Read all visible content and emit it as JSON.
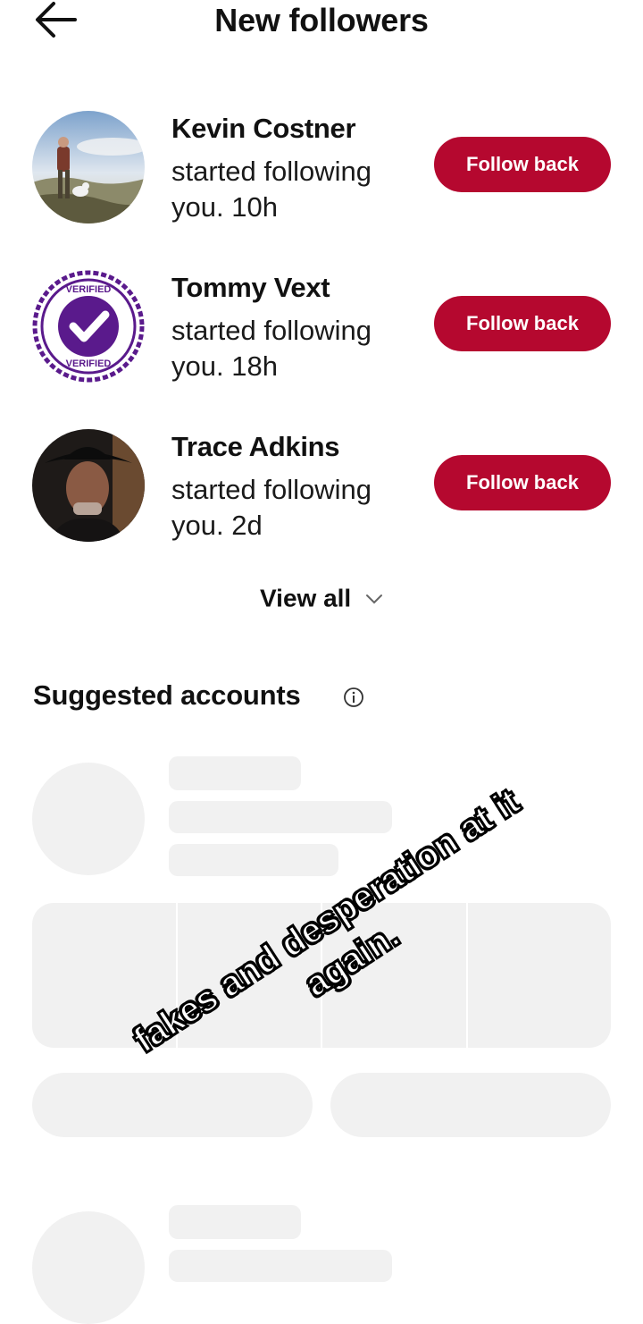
{
  "header": {
    "title": "New followers",
    "back_icon": "arrow-left-icon"
  },
  "followers": [
    {
      "name": "Kevin Costner",
      "activity": "started following you. 10h",
      "button": "Follow back",
      "avatar": "photo-hiker-with-dog"
    },
    {
      "name": "Tommy Vext",
      "activity": "started following you. 18h",
      "button": "Follow back",
      "avatar": "verified-badge-image",
      "badge_text": "VERIFIED"
    },
    {
      "name": "Trace Adkins",
      "activity": "started following you. 2d",
      "button": "Follow back",
      "avatar": "photo-man-in-cowboy-hat"
    }
  ],
  "view_all": {
    "label": "View all",
    "icon": "chevron-down-icon"
  },
  "suggested": {
    "title": "Suggested accounts",
    "icon": "info-icon"
  },
  "overlay_caption": "fakes and desperation at it again.",
  "colors": {
    "accent": "#b5082f",
    "skeleton": "#f1f1f1",
    "badge_purple": "#5a1a8c"
  }
}
